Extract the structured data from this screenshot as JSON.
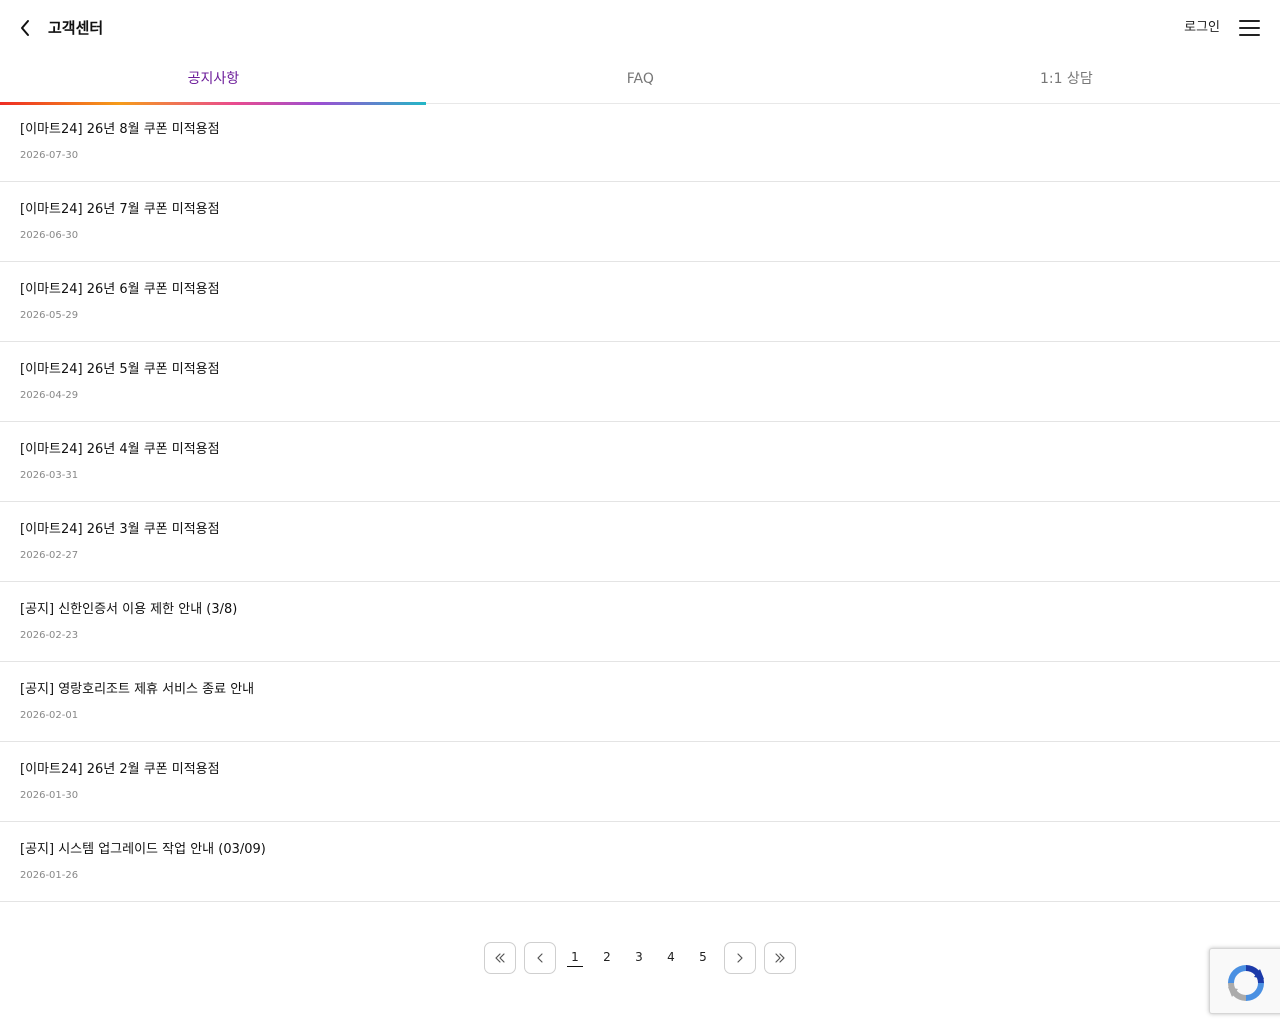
{
  "header": {
    "title": "고객센터",
    "login_label": "로그인",
    "back_icon": "chevron-left-icon",
    "menu_icon": "hamburger-menu-icon"
  },
  "tabs": [
    {
      "label": "공지사항",
      "active": true
    },
    {
      "label": "FAQ",
      "active": false
    },
    {
      "label": "1:1 상담",
      "active": false
    }
  ],
  "colors": {
    "active_tab": "#6c1d9a",
    "underline_gradient": [
      "#ee2d24",
      "#f59c1a",
      "#e94b8f",
      "#9b4fd2",
      "#22b7c6"
    ]
  },
  "notices": [
    {
      "title": "[이마트24] 26년 8월 쿠폰 미적용점",
      "date": "2026-07-30"
    },
    {
      "title": "[이마트24] 26년 7월 쿠폰 미적용점",
      "date": "2026-06-30"
    },
    {
      "title": "[이마트24] 26년 6월 쿠폰 미적용점",
      "date": "2026-05-29"
    },
    {
      "title": "[이마트24] 26년 5월 쿠폰 미적용점",
      "date": "2026-04-29"
    },
    {
      "title": "[이마트24] 26년 4월 쿠폰 미적용점",
      "date": "2026-03-31"
    },
    {
      "title": "[이마트24] 26년 3월 쿠폰 미적용점",
      "date": "2026-02-27"
    },
    {
      "title": "[공지] 신한인증서 이용 제한 안내 (3/8)",
      "date": "2026-02-23"
    },
    {
      "title": "[공지] 영랑호리조트 제휴 서비스 종료 안내",
      "date": "2026-02-01"
    },
    {
      "title": "[이마트24] 26년 2월 쿠폰 미적용점",
      "date": "2026-01-30"
    },
    {
      "title": "[공지] 시스템 업그레이드 작업 안내 (03/09)",
      "date": "2026-01-26"
    }
  ],
  "pagination": {
    "pages": [
      "1",
      "2",
      "3",
      "4",
      "5"
    ],
    "current": "1",
    "icons": [
      "double-chevron-left-icon",
      "chevron-left-icon",
      "chevron-right-icon",
      "double-chevron-right-icon"
    ]
  },
  "recaptcha": {
    "icon": "recaptcha-logo-icon"
  }
}
